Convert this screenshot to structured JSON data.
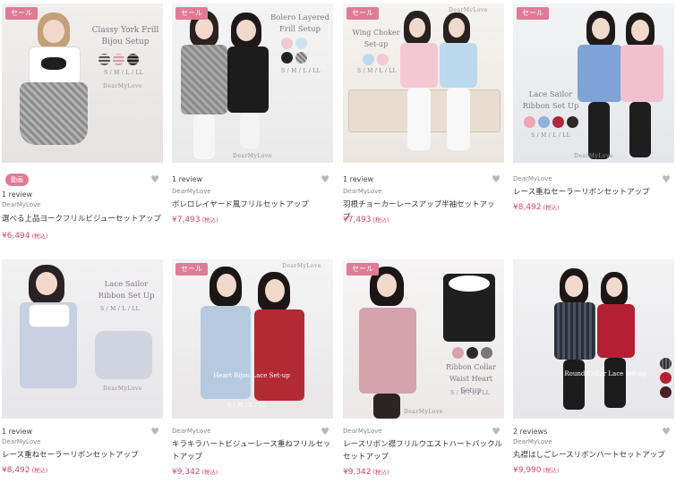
{
  "products": [
    {
      "sale": "セール",
      "video": "動画",
      "title_overlay": [
        "Classy York Frill",
        "Bijou Setup"
      ],
      "sizes": "S / M / L / LL",
      "reviews": "1 review",
      "brand": "DearMyLove",
      "name": "選べる上品ヨークフリルビジューセットアップ",
      "price": "¥6,494",
      "tax": "(税込)",
      "swatches": [
        "#d8d8d8",
        "#e6c4cc",
        "#555555"
      ]
    },
    {
      "sale": "セール",
      "title_overlay": [
        "Bolero Layered",
        "Frill Setup"
      ],
      "sizes": "S / M / L / LL",
      "reviews": "1 review",
      "brand": "DearMyLove",
      "name": "ボレロレイヤード風フリルセットアップ",
      "price": "¥7,493",
      "tax": "(税込)",
      "swatches": [
        "#f2c9d1",
        "#cfe2f1",
        "#222222",
        "#aaaaaa"
      ]
    },
    {
      "sale": "セール",
      "title_overlay": [
        "Wing Choker",
        "Set-up"
      ],
      "sizes": "S / M / L / LL",
      "reviews": "1 review",
      "brand": "DearMyLove",
      "name": "羽根チョーカーレースアップ半袖セットアップ",
      "price": "¥7,493",
      "tax": "(税込)",
      "swatches": [
        "#bcd9ee",
        "#f3c9d3"
      ]
    },
    {
      "sale": "セール",
      "title_overlay": [
        "Lace Sailor",
        "Ribbon Set Up"
      ],
      "sizes": "S / M / L / LL",
      "reviews": "",
      "brand": "DearMyLove",
      "name": "レース重ねセーラーリボンセットアップ",
      "price": "¥8,492",
      "tax": "(税込)",
      "swatches": [
        "#f0a4b4",
        "#8fb2dc",
        "#b0283c",
        "#2a2a2a"
      ]
    },
    {
      "sale": "",
      "title_overlay": [
        "Lace Sailor",
        "Ribbon Set Up"
      ],
      "sizes": "S / M / L / LL",
      "reviews": "1 review",
      "brand": "DearMyLove",
      "name": "レース重ねセーラーリボンセットアップ",
      "price": "¥8,492",
      "tax": "(税込)",
      "swatches": []
    },
    {
      "sale": "セール",
      "title_overlay": [
        "Heart Bijou Lace Set-up"
      ],
      "sizes": "S / M / L / LL",
      "reviews": "",
      "brand": "DearMyLove",
      "name": "キラキラハートビジューレース重ねフリルセットアップ",
      "price": "¥9,342",
      "tax": "(税込)",
      "swatches": [
        "#2a2a2a",
        "#b22a34"
      ]
    },
    {
      "sale": "セール",
      "title_overlay": [
        "Ribbon Collar",
        "Waist Heart Setup"
      ],
      "sizes": "S / M / L / LL",
      "reviews": "",
      "brand": "DearMyLove",
      "name": "レースリボン襟フリルウエストハートバックルセットアップ",
      "price": "¥9,342",
      "tax": "(税込)",
      "swatches": [
        "#d5a3ab",
        "#2a2a2a",
        "#777777"
      ]
    },
    {
      "sale": "",
      "title_overlay": [
        "Round Collar Lace Set-up"
      ],
      "sizes": "",
      "reviews": "2 reviews",
      "brand": "DearMyLove",
      "name": "丸襟はしごレースリボンハートセットアップ",
      "price": "¥9,990",
      "tax": "(税込)",
      "swatches": []
    }
  ],
  "brand_mark": "DearMyLove",
  "heart_icon": "♥",
  "colors": {
    "sale_badge": "#e07a95",
    "price": "#d34a6a"
  }
}
